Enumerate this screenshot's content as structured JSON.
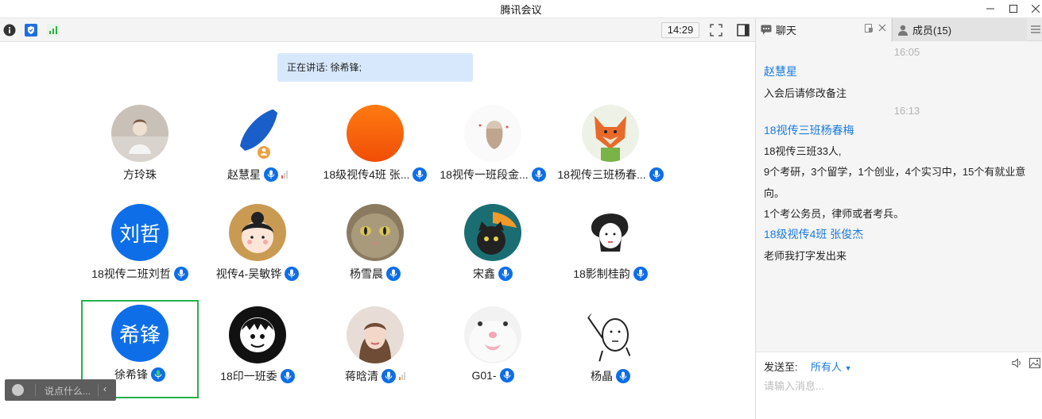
{
  "window": {
    "title": "腾讯会议"
  },
  "toolbar": {
    "clock": "14:29"
  },
  "speaking": {
    "label": "正在讲话: 徐希锋;"
  },
  "participants": [
    {
      "name": "方玲珠",
      "mic": false,
      "signal": false,
      "avatar": "photo-girl"
    },
    {
      "name": "赵慧星",
      "mic": true,
      "signal": true,
      "signal_color": "#e05a4b",
      "avatar": "photo-leaf"
    },
    {
      "name": "18级视传4班 张...",
      "mic": true,
      "signal": false,
      "avatar": "gradient-orange"
    },
    {
      "name": "18视传一班段金...",
      "mic": true,
      "signal": false,
      "avatar": "photo-sketch"
    },
    {
      "name": "18视传三班杨春...",
      "mic": true,
      "signal": false,
      "avatar": "photo-fox"
    },
    {
      "name": "18视传二班刘哲",
      "mic": true,
      "signal": false,
      "avatar": "text",
      "avatar_text": "刘哲"
    },
    {
      "name": "视传4-吴敏铧",
      "mic": true,
      "signal": false,
      "avatar": "photo-cartoon"
    },
    {
      "name": "杨雪晨",
      "mic": true,
      "signal": false,
      "avatar": "photo-cat"
    },
    {
      "name": "宋鑫",
      "mic": true,
      "signal": false,
      "avatar": "photo-blackcat"
    },
    {
      "name": "18影制桂韵",
      "mic": true,
      "signal": false,
      "avatar": "photo-drawing"
    },
    {
      "name": "徐希锋",
      "mic": true,
      "signal": false,
      "avatar": "text",
      "avatar_text": "希锋",
      "active": true
    },
    {
      "name": "18印一班委",
      "mic": true,
      "signal": false,
      "avatar": "photo-bw"
    },
    {
      "name": "蒋晗清",
      "mic": true,
      "signal": true,
      "signal_color": "#f08a24",
      "avatar": "photo-woman"
    },
    {
      "name": "G01-",
      "mic": true,
      "signal": false,
      "avatar": "photo-whitecat"
    },
    {
      "name": "杨晶",
      "mic": true,
      "signal": false,
      "avatar": "photo-doodle"
    }
  ],
  "quick_input": {
    "placeholder": "说点什么..."
  },
  "panel": {
    "tab_chat": "聊天",
    "tab_members": "成员(15)"
  },
  "chat": {
    "ts1": "16:05",
    "sender1": "赵慧星",
    "msg1": "入会后请修改备注",
    "ts2": "16:13",
    "sender2": "18视传三班杨春梅",
    "msg2a": "18视传三班33人,",
    "msg2b": "9个考研，3个留学，1个创业，4个实习中，15个有就业意",
    "msg2c": "向。",
    "msg2d": "1个考公务员，律师或者考兵。",
    "sender3": "18级视传4班 张俊杰",
    "msg3": "老师我打字发出来"
  },
  "send": {
    "label": "发送至:",
    "target": "所有人",
    "placeholder": "请输入消息..."
  },
  "colors": {
    "accent": "#0d6ee8",
    "active_border": "#22b14c",
    "link": "#1a7be0"
  }
}
